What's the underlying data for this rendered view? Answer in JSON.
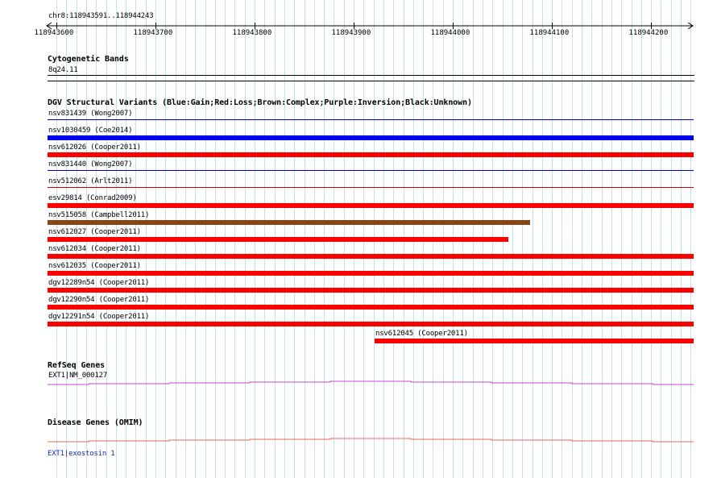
{
  "region": "chr8:118943591..118944243",
  "ruler": {
    "ticks": [
      "118943600",
      "118943700",
      "118943800",
      "118943900",
      "118944000",
      "118944100",
      "118944200"
    ]
  },
  "tracks": {
    "cyto": {
      "title": "Cytogenetic Bands",
      "band": "8q24.11"
    },
    "dgv": {
      "title": "DGV Structural Variants (Blue:Gain;Red:Loss;Brown:Complex;Purple:Inversion;Black:Unknown)",
      "features": [
        {
          "label": "nsv831439 (Wong2007)",
          "type": "gain",
          "color": "#0000cc",
          "start": 118943591,
          "end": 118944243,
          "thin": true
        },
        {
          "label": "nsv1030459 (Coe2014)",
          "type": "gain",
          "color": "#0000ee",
          "start": 118943591,
          "end": 118944243
        },
        {
          "label": "nsv612026 (Cooper2011)",
          "type": "loss",
          "color": "#ff0000",
          "start": 118943591,
          "end": 118944243
        },
        {
          "label": "nsv831440 (Wong2007)",
          "type": "gain",
          "color": "#0000cc",
          "start": 118943591,
          "end": 118944243,
          "thin": true
        },
        {
          "label": "nsv512062 (Arlt2011)",
          "type": "loss",
          "color": "#cc0000",
          "start": 118943591,
          "end": 118944243,
          "thin": true
        },
        {
          "label": "esv29814 (Conrad2009)",
          "type": "loss",
          "color": "#ff0000",
          "start": 118943591,
          "end": 118944243
        },
        {
          "label": "nsv515058 (Campbell2011)",
          "type": "complex",
          "color": "#8b4513",
          "start": 118943591,
          "end": 118944078
        },
        {
          "label": "nsv612027 (Cooper2011)",
          "type": "loss",
          "color": "#ff0000",
          "start": 118943591,
          "end": 118944056
        },
        {
          "label": "nsv612034 (Cooper2011)",
          "type": "loss",
          "color": "#ff0000",
          "start": 118943591,
          "end": 118944243
        },
        {
          "label": "nsv612035 (Cooper2011)",
          "type": "loss",
          "color": "#ff0000",
          "start": 118943591,
          "end": 118944243
        },
        {
          "label": "dgv12289n54 (Cooper2011)",
          "type": "loss",
          "color": "#ff0000",
          "start": 118943591,
          "end": 118944243
        },
        {
          "label": "dgv12290n54 (Cooper2011)",
          "type": "loss",
          "color": "#ff0000",
          "start": 118943591,
          "end": 118944243
        },
        {
          "label": "dgv12291n54 (Cooper2011)",
          "type": "loss",
          "color": "#ff0000",
          "start": 118943591,
          "end": 118944243
        },
        {
          "label": "nsv612045 (Cooper2011)",
          "type": "loss",
          "color": "#ff0000",
          "start": 118943921,
          "end": 118944243
        }
      ]
    },
    "refseq": {
      "title": "RefSeq Genes",
      "gene": "EXT1|NM_000127",
      "color": "#cc44cc"
    },
    "omim": {
      "title": "Disease Genes (OMIM)",
      "gene": "EXT1|exostosin 1",
      "color": "#ee6655"
    }
  }
}
